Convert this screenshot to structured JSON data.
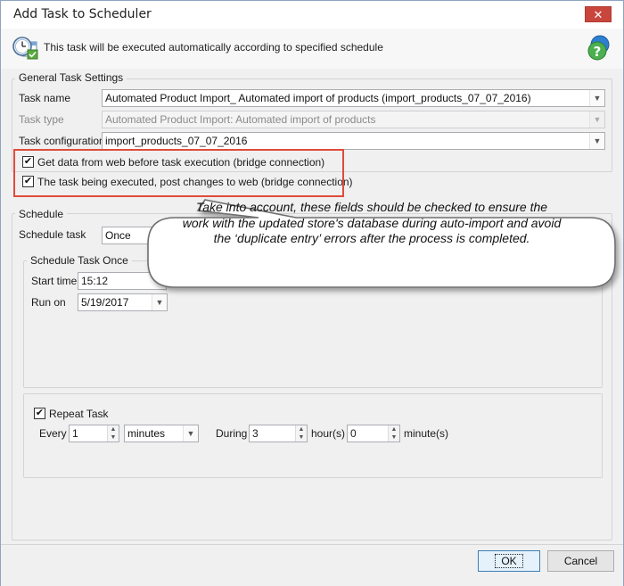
{
  "window": {
    "title": "Add Task to Scheduler",
    "close_glyph": "✕"
  },
  "header": {
    "text": "This task will be executed automatically according to specified schedule",
    "left_icon": "clock-calendar-icon",
    "right_icon": "help-icon"
  },
  "general": {
    "group_label": "General Task Settings",
    "task_name_label": "Task name",
    "task_name_value": "Automated Product Import_ Automated import of products (import_products_07_07_2016)",
    "task_type_label": "Task type",
    "task_type_value": "Automated Product Import: Automated import of products",
    "task_config_label": "Task configuration",
    "task_config_value": "import_products_07_07_2016",
    "get_data_label": "Get data from web before task execution (bridge connection)",
    "get_data_checked": true,
    "post_changes_label": "The task being executed, post changes to web (bridge connection)",
    "post_changes_checked": true
  },
  "schedule": {
    "group_label": "Schedule",
    "schedule_task_label": "Schedule task",
    "schedule_task_value": "Once",
    "once_group_label": "Schedule Task Once",
    "start_time_label": "Start time",
    "start_time_value": "15:12",
    "run_on_label": "Run on",
    "run_on_value": "5/19/2017",
    "repeat_label": "Repeat Task",
    "repeat_checked": true,
    "every_label": "Every",
    "every_value": "1",
    "every_unit_value": "minutes",
    "during_label": "During",
    "during_value": "3",
    "hours_label": "hour(s)",
    "minutes_value": "0",
    "minutes_label": "minute(s)"
  },
  "callout": {
    "line1": "Take into account, these fields should be checked to ensure the",
    "line2": "work with the updated store's database during auto-import and avoid",
    "line3": "the ‘duplicate entry’ errors  after the process is completed."
  },
  "buttons": {
    "ok_label": "OK",
    "cancel_label": "Cancel"
  },
  "colors": {
    "highlight_border": "#e04b3c",
    "dialog_background": "#f0f0f0",
    "default_button_border": "#3c7fb1"
  }
}
